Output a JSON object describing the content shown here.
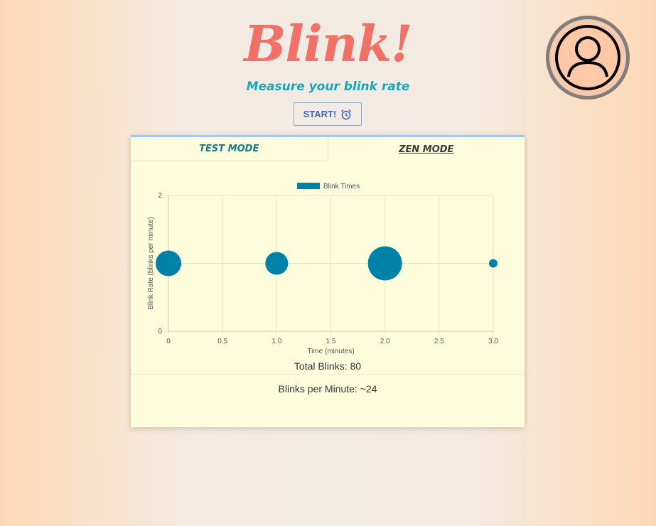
{
  "app": {
    "title": "Blink!",
    "subtitle": "Measure your blink rate"
  },
  "start_button": {
    "label": "START!",
    "icon": "alarm-clock-icon"
  },
  "avatar": {
    "icon": "user-icon"
  },
  "tabs": [
    {
      "label": "TEST MODE"
    },
    {
      "label": "ZEN MODE"
    }
  ],
  "stats": {
    "total_blinks": "Total Blinks: 80",
    "blinks_per_minute": "Blinks per Minute: ~24"
  },
  "colors": {
    "title": "#f07167",
    "subtitle": "#1aa8b5",
    "bubble": "#0081a7",
    "card": "#fdfcdc"
  },
  "chart_data": {
    "type": "scatter",
    "legend": "Blink Times",
    "legend_position": "top",
    "xlabel": "Time (minutes)",
    "ylabel": "Blink Rate (blinks per minute)",
    "xlim": [
      0,
      3
    ],
    "ylim": [
      0,
      2
    ],
    "x_ticks": [
      "0",
      "0.5",
      "1.0",
      "1.5",
      "2.0",
      "2.5",
      "3.0"
    ],
    "y_ticks": [
      "0",
      "2"
    ],
    "grid": true,
    "series": [
      {
        "name": "Blink Times",
        "points": [
          {
            "x": 0,
            "y": 1,
            "r": 18
          },
          {
            "x": 1,
            "y": 1,
            "r": 16
          },
          {
            "x": 2,
            "y": 1,
            "r": 24
          },
          {
            "x": 3,
            "y": 1,
            "r": 6
          }
        ]
      }
    ]
  }
}
